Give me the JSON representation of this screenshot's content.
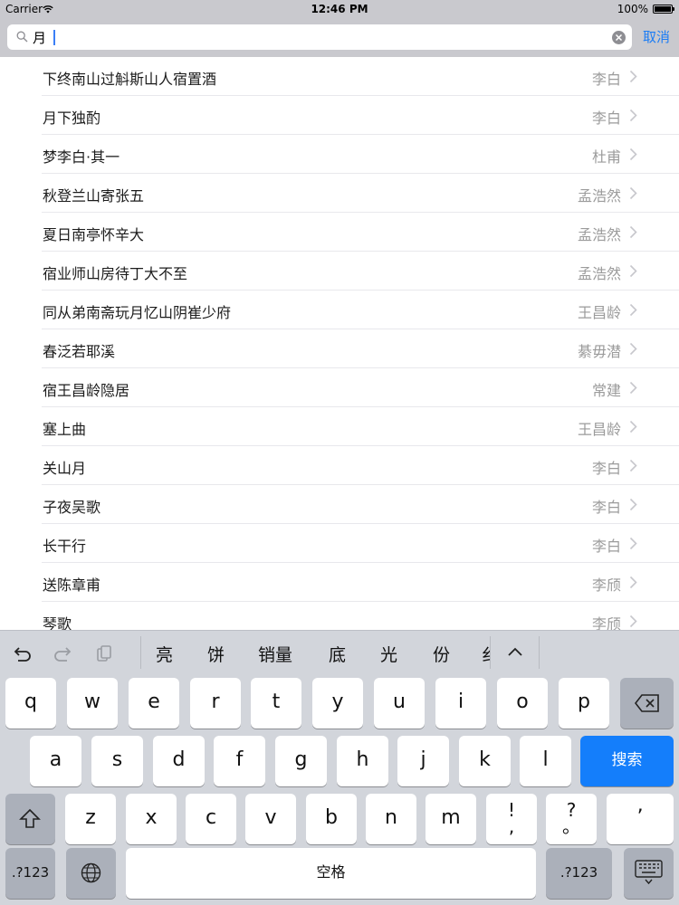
{
  "status_bar": {
    "carrier": "Carrier",
    "time": "12:46 PM",
    "battery": "100%"
  },
  "search": {
    "value": "月",
    "cancel_label": "取消"
  },
  "poems": [
    {
      "title": "下终南山过斛斯山人宿置酒",
      "author": "李白"
    },
    {
      "title": "月下独酌",
      "author": "李白"
    },
    {
      "title": "梦李白·其一",
      "author": "杜甫"
    },
    {
      "title": "秋登兰山寄张五",
      "author": "孟浩然"
    },
    {
      "title": "夏日南亭怀辛大",
      "author": "孟浩然"
    },
    {
      "title": "宿业师山房待丁大不至",
      "author": "孟浩然"
    },
    {
      "title": "同从弟南斋玩月忆山阴崔少府",
      "author": "王昌龄"
    },
    {
      "title": "春泛若耶溪",
      "author": "綦毋潜"
    },
    {
      "title": "宿王昌龄隐居",
      "author": "常建"
    },
    {
      "title": "塞上曲",
      "author": "王昌龄"
    },
    {
      "title": "关山月",
      "author": "李白"
    },
    {
      "title": "子夜吴歌",
      "author": "李白"
    },
    {
      "title": "长干行",
      "author": "李白"
    },
    {
      "title": "送陈章甫",
      "author": "李颀"
    },
    {
      "title": "琴歌",
      "author": "李颀"
    }
  ],
  "keyboard": {
    "candidates": [
      "亮",
      "饼",
      "销量",
      "底",
      "光",
      "份",
      "纟"
    ],
    "row1": [
      "q",
      "w",
      "e",
      "r",
      "t",
      "y",
      "u",
      "i",
      "o",
      "p"
    ],
    "row2": [
      "a",
      "s",
      "d",
      "f",
      "g",
      "h",
      "j",
      "k",
      "l"
    ],
    "row3": [
      "z",
      "x",
      "c",
      "v",
      "b",
      "n",
      "m"
    ],
    "punct1": {
      "top": "!",
      "bottom": ","
    },
    "punct2": {
      "top": "?",
      "bottom": "。"
    },
    "apostrophe": "’",
    "search_key": "搜索",
    "numbers_key": ".?123",
    "space_key": "空格",
    "icons": {
      "undo": "undo-icon",
      "redo": "redo-icon",
      "paste": "paste-icon",
      "expand": "chevron-up-icon",
      "delete": "backspace-icon",
      "shift": "shift-icon",
      "globe": "globe-icon",
      "dismiss": "keyboard-dismiss-icon"
    }
  },
  "colors": {
    "accent": "#1a7cf5",
    "search_key": "#147efb",
    "keyboard_bg": "#d2d5db",
    "header_bg": "#c9c9ce"
  }
}
